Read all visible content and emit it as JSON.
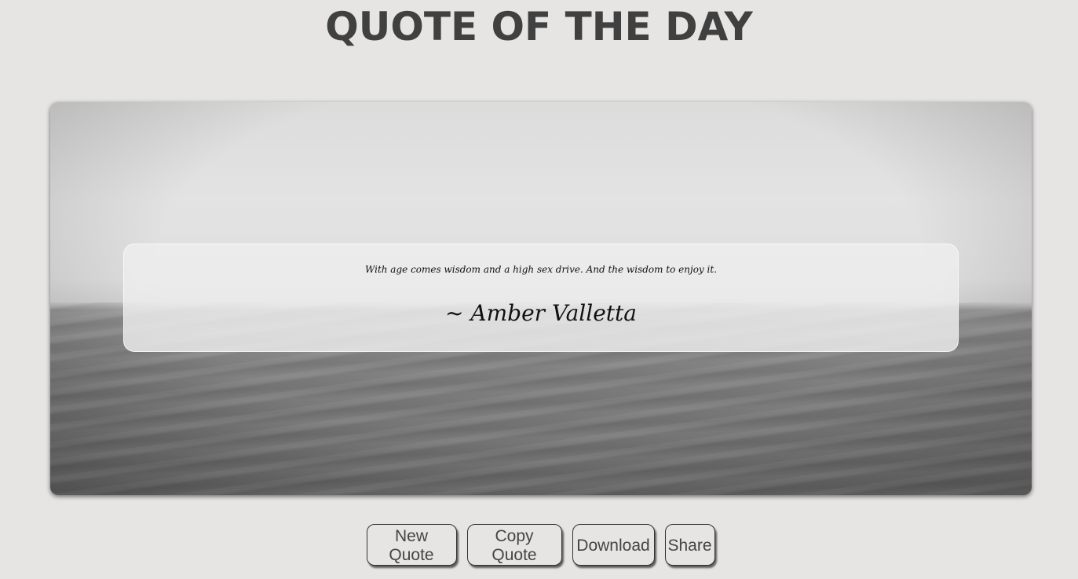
{
  "header": {
    "title": "QUOTE OF THE DAY"
  },
  "quote": {
    "text": "With age comes wisdom and a high sex drive. And the wisdom to enjoy it.",
    "author": "~ Amber Valletta"
  },
  "actions": {
    "new_quote": "New Quote",
    "copy_quote": "Copy Quote",
    "download": "Download",
    "share": "Share"
  },
  "colors": {
    "background": "#e6e5e4",
    "title": "#404040",
    "button_border": "#333333"
  }
}
